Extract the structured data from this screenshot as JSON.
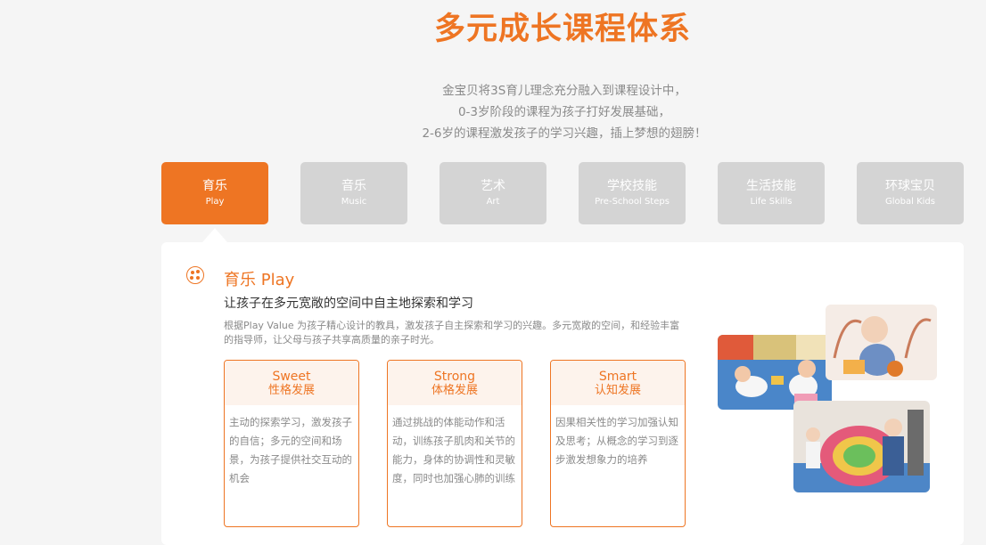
{
  "title": "多元成长课程体系",
  "intro": [
    "金宝贝将3S育儿理念充分融入到课程设计中，",
    "0-3岁阶段的课程为孩子打好发展基础，",
    "2-6岁的课程激发孩子的学习兴趣，插上梦想的翅膀！"
  ],
  "tabs": [
    {
      "cn": "育乐",
      "en": "Play",
      "active": true
    },
    {
      "cn": "音乐",
      "en": "Music",
      "active": false
    },
    {
      "cn": "艺术",
      "en": "Art",
      "active": false
    },
    {
      "cn": "学校技能",
      "en": "Pre-School Steps",
      "active": false
    },
    {
      "cn": "生活技能",
      "en": "Life Skills",
      "active": false
    },
    {
      "cn": "环球宝贝",
      "en": "Global Kids",
      "active": false
    }
  ],
  "panel": {
    "icon": "ball-icon",
    "heading": "育乐 Play",
    "subtitle": "让孩子在多元宽敞的空间中自主地探索和学习",
    "description": "根据Play Value 为孩子精心设计的教具，激发孩子自主探索和学习的兴趣。多元宽敞的空间，和经验丰富的指导师，让父母与孩子共享高质量的亲子时光。",
    "cards": [
      {
        "en": "Sweet",
        "cn": "性格发展",
        "text": "主动的探索学习，激发孩子的自信；多元的空间和场景，为孩子提供社交互动的机会"
      },
      {
        "en": "Strong",
        "cn": "体格发展",
        "text": "通过挑战的体能动作和活动，训练孩子肌肉和关节的能力，身体的协调性和灵敏度，同时也加强心肺的训练"
      },
      {
        "en": "Smart",
        "cn": "认知发展",
        "text": "因果相关性的学习加强认知及思考；从概念的学习到逐步激发想象力的培养"
      }
    ]
  },
  "colors": {
    "accent": "#ee7523",
    "tab_inactive": "#d4d4d4",
    "background": "#f5f5f5"
  }
}
